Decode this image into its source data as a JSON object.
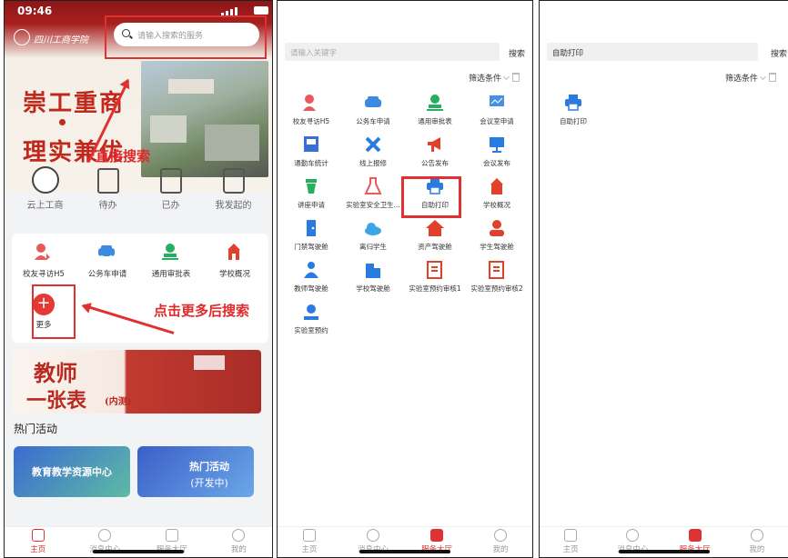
{
  "panel1": {
    "status_time": "09:46",
    "school_name": "四川工商学院",
    "search_placeholder": "请输入搜索的服务",
    "slogan_line1": "崇工重商",
    "slogan_line2": "理实兼优",
    "annotation_search": "直接搜索",
    "annotation_more": "点击更多后搜索",
    "quick_items": [
      {
        "label": "云上工商",
        "icon": "school-emblem-icon"
      },
      {
        "label": "待办",
        "icon": "todo-doc-icon"
      },
      {
        "label": "已办",
        "icon": "done-doc-icon"
      },
      {
        "label": "我发起的",
        "icon": "initiated-icon"
      }
    ],
    "services": [
      {
        "label": "校友寻访H5",
        "icon": "alumni-icon",
        "color": "#e85a5a"
      },
      {
        "label": "公务车申请",
        "icon": "car-icon",
        "color": "#3b8be0"
      },
      {
        "label": "通用审批表",
        "icon": "approval-stamp-icon",
        "color": "#27ae60"
      },
      {
        "label": "学校概况",
        "icon": "school-building-icon",
        "color": "#e0412b"
      }
    ],
    "more_label": "更多",
    "banner_title1": "教师",
    "banner_title2": "一张表",
    "banner_suffix": "(内测)",
    "hot_title": "热门活动",
    "hot_cards": [
      "教育教学资源中心",
      "热门活动",
      "(开发中)"
    ],
    "tabs": [
      "主页",
      "消息中心",
      "服务大厅",
      "我的"
    ],
    "active_tab": "主页"
  },
  "panel2": {
    "search_placeholder": "请输入关键字",
    "search_button": "搜索",
    "filter_label": "筛选条件",
    "services": [
      {
        "label": "校友寻访H5",
        "icon": "alumni-icon",
        "color": "#e85a5a"
      },
      {
        "label": "公务车申请",
        "icon": "car-icon",
        "color": "#3b8be0"
      },
      {
        "label": "通用审批表",
        "icon": "approval-stamp-icon",
        "color": "#27ae60"
      },
      {
        "label": "会议室申请",
        "icon": "meeting-room-icon",
        "color": "#4a90e2"
      },
      {
        "label": "通勤车统计",
        "icon": "bus-stats-icon",
        "color": "#3b6fd8"
      },
      {
        "label": "线上报修",
        "icon": "repair-tools-icon",
        "color": "#2a7be0"
      },
      {
        "label": "公告发布",
        "icon": "megaphone-icon",
        "color": "#e0412b"
      },
      {
        "label": "会议发布",
        "icon": "presentation-icon",
        "color": "#2a7be0"
      },
      {
        "label": "讲座申请",
        "icon": "lectern-icon",
        "color": "#27ae60"
      },
      {
        "label": "实验室安全卫生...",
        "icon": "flask-icon",
        "color": "#e85a5a"
      },
      {
        "label": "自助打印",
        "icon": "printer-icon",
        "color": "#2a7be0"
      },
      {
        "label": "学校概况",
        "icon": "school-building-icon",
        "color": "#e0412b"
      },
      {
        "label": "门禁驾驶舱",
        "icon": "door-icon",
        "color": "#2a7be0"
      },
      {
        "label": "离归学生",
        "icon": "cloud-icon",
        "color": "#3aa6e8"
      },
      {
        "label": "资产驾驶舱",
        "icon": "home-assets-icon",
        "color": "#e0412b"
      },
      {
        "label": "学生驾驶舱",
        "icon": "student-icon",
        "color": "#e0412b"
      },
      {
        "label": "教师驾驶舱",
        "icon": "teacher-icon",
        "color": "#2a7be0"
      },
      {
        "label": "学校驾驶舱",
        "icon": "building-icon",
        "color": "#2a7be0"
      },
      {
        "label": "实验室预约审核1",
        "icon": "lab-review-icon",
        "color": "#e0412b"
      },
      {
        "label": "实验室预约审核2",
        "icon": "lab-review-icon",
        "color": "#e0412b"
      },
      {
        "label": "实验室预约",
        "icon": "lab-booking-icon",
        "color": "#2a7be0"
      }
    ],
    "tabs": [
      "主页",
      "消息中心",
      "服务大厅",
      "我的"
    ],
    "active_tab": "服务大厅"
  },
  "panel3": {
    "search_value": "自助打印",
    "search_button": "搜索",
    "filter_label": "筛选条件",
    "result": {
      "label": "自助打印",
      "icon": "printer-icon",
      "color": "#2a7be0"
    },
    "tabs": [
      "主页",
      "消息中心",
      "服务大厅",
      "我的"
    ],
    "active_tab": "服务大厅"
  }
}
